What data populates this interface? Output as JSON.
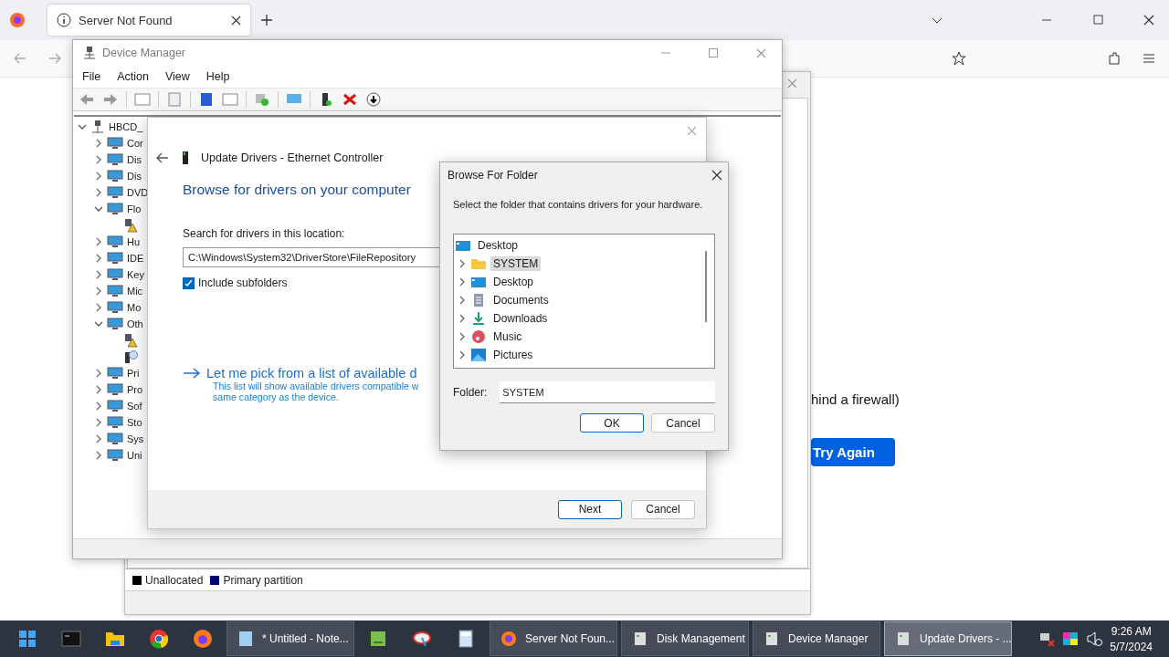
{
  "browser": {
    "tabs": [
      {
        "title": "Server Not Found",
        "selected": true
      }
    ],
    "page": {
      "text": "hind a firewall)",
      "button": "Try Again"
    }
  },
  "disk_management": {
    "legend": [
      {
        "label": "Unallocated",
        "color": "#000000"
      },
      {
        "label": "Primary partition",
        "color": "#000080"
      }
    ]
  },
  "device_manager": {
    "title": "Device Manager",
    "menu": [
      "File",
      "Action",
      "View",
      "Help"
    ],
    "tree": {
      "label": "HBCD_",
      "expanded": true,
      "children": [
        {
          "label": "Cor",
          "expanded": false
        },
        {
          "label": "Dis",
          "expanded": false
        },
        {
          "label": "Dis",
          "expanded": false
        },
        {
          "label": "DVD",
          "expanded": false
        },
        {
          "label": "Flo",
          "expanded": true,
          "children": [
            {
              "kind": "warning"
            }
          ]
        },
        {
          "label": "Hu",
          "expanded": false
        },
        {
          "label": "IDE",
          "expanded": false
        },
        {
          "label": "Key",
          "expanded": false
        },
        {
          "label": "Mic",
          "expanded": false
        },
        {
          "label": "Mo",
          "expanded": false
        },
        {
          "label": "Oth",
          "expanded": true,
          "children": [
            {
              "kind": "warning"
            },
            {
              "kind": "unknown"
            }
          ]
        },
        {
          "label": "Pri",
          "expanded": false
        },
        {
          "label": "Pro",
          "expanded": false
        },
        {
          "label": "Sof",
          "expanded": false
        },
        {
          "label": "Sto",
          "expanded": false
        },
        {
          "label": "Sys",
          "expanded": false
        },
        {
          "label": "Uni",
          "expanded": false
        }
      ]
    }
  },
  "update_drivers": {
    "title": "Update Drivers - Ethernet Controller",
    "heading": "Browse for drivers on your computer",
    "field_label": "Search for drivers in this location:",
    "path": "C:\\Windows\\System32\\DriverStore\\FileRepository",
    "include_subfolders": {
      "label": "Include subfolders",
      "checked": true
    },
    "link": "Let me pick from a list of available d",
    "description_lines": [
      "This list will show available drivers compatible w",
      "same category as the device."
    ],
    "buttons": [
      "Next",
      "Cancel"
    ]
  },
  "browse_folder": {
    "title": "Browse For Folder",
    "prompt": "Select the folder that contains drivers for your hardware.",
    "root": "Desktop",
    "items": [
      {
        "label": "SYSTEM",
        "kind": "folder",
        "selected": true
      },
      {
        "label": "Desktop",
        "kind": "desktop",
        "selected": false
      },
      {
        "label": "Documents",
        "kind": "documents",
        "selected": false
      },
      {
        "label": "Downloads",
        "kind": "downloads",
        "selected": false
      },
      {
        "label": "Music",
        "kind": "music",
        "selected": false
      },
      {
        "label": "Pictures",
        "kind": "pictures",
        "selected": false
      }
    ],
    "folder_label": "Folder:",
    "folder_value": "SYSTEM",
    "buttons": [
      "OK",
      "Cancel"
    ]
  },
  "taskbar": {
    "windows": [
      {
        "label": "* Untitled - Note...",
        "selected": false
      },
      {
        "label": "Server Not Foun...",
        "selected": false
      },
      {
        "label": "Disk Management",
        "selected": false
      },
      {
        "label": "Device Manager",
        "selected": false
      },
      {
        "label": "Update Drivers - ...",
        "selected": true
      }
    ],
    "time": "9:26 AM",
    "date": "5/7/2024"
  }
}
